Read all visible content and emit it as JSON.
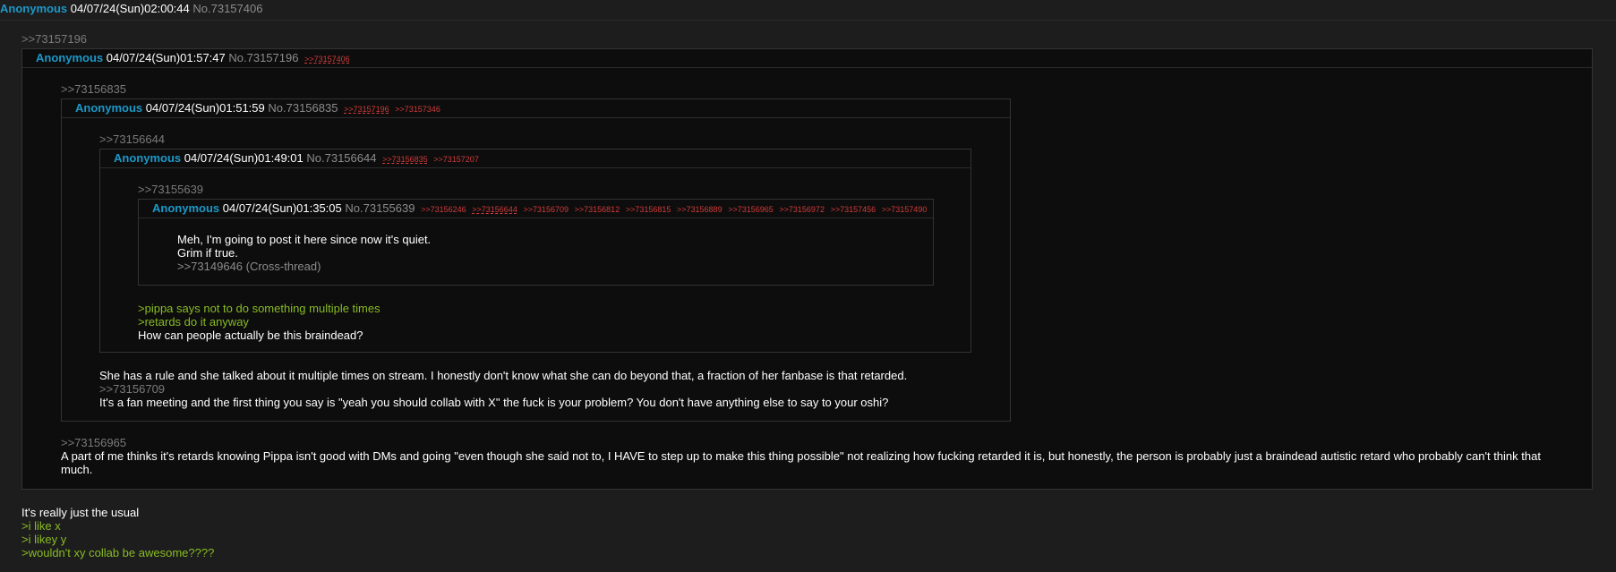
{
  "top_post": {
    "name": "Anonymous",
    "date": "04/07/24(Sun)02:00:44",
    "number": "No.73157406"
  },
  "quote_73157196": ">>73157196",
  "post_73157196": {
    "name": "Anonymous",
    "date": "04/07/24(Sun)01:57:47",
    "number": "No.73157196",
    "replies": [
      ">>73157406"
    ]
  },
  "quote_73156835": ">>73156835",
  "post_73156835": {
    "name": "Anonymous",
    "date": "04/07/24(Sun)01:51:59",
    "number": "No.73156835",
    "replies": [
      ">>73157196",
      ">>73157346"
    ]
  },
  "quote_73156644": ">>73156644",
  "post_73156644": {
    "name": "Anonymous",
    "date": "04/07/24(Sun)01:49:01",
    "number": "No.73156644",
    "replies": [
      ">>73156835",
      ">>73157207"
    ]
  },
  "quote_73155639": ">>73155639",
  "post_73155639": {
    "name": "Anonymous",
    "date": "04/07/24(Sun)01:35:05",
    "number": "No.73155639",
    "replies": [
      ">>73156246",
      ">>73156644",
      ">>73156709",
      ">>73156812",
      ">>73156815",
      ">>73156889",
      ">>73156965",
      ">>73156972",
      ">>73157456",
      ">>73157490"
    ],
    "body": [
      "Meh, I'm going to post it here since now it's quiet.",
      "Grim if true."
    ],
    "cross_link": ">>73149646 (Cross-thread)"
  },
  "post_73156644_body": {
    "green": [
      ">pippa says not to do something multiple times",
      ">retards do it anyway"
    ],
    "text": "How can people actually be this braindead?"
  },
  "post_73156835_body": {
    "text1": "She has a rule and she talked about it multiple times on stream. I honestly don't know what she can do beyond that, a fraction of her fanbase is that retarded.",
    "quote": ">>73156709",
    "text2": "It's a fan meeting and the first thing you say is \"yeah you should collab with X\" the fuck is your problem? You don't have anything else to say to your oshi?"
  },
  "post_73157196_body": {
    "quote": ">>73156965",
    "text": "A part of me thinks it's retards knowing Pippa isn't good with DMs and going \"even though she said not to, I HAVE to step up to make this thing possible\" not realizing how fucking retarded it is, but honestly, the person is probably just a braindead autistic retard who probably can't think that much."
  },
  "top_post_body": {
    "text": "It's really just the usual",
    "green": [
      ">i like x",
      ">i likey y",
      ">wouldn't xy collab be awesome????"
    ]
  },
  "colors": {
    "name": "#1c98c8",
    "greentext": "#88bb22",
    "reply_link": "#d23a3a",
    "quotelink": "#7a7a7a",
    "background": "#1d1d1d",
    "post_background": "#0d0d0d"
  }
}
